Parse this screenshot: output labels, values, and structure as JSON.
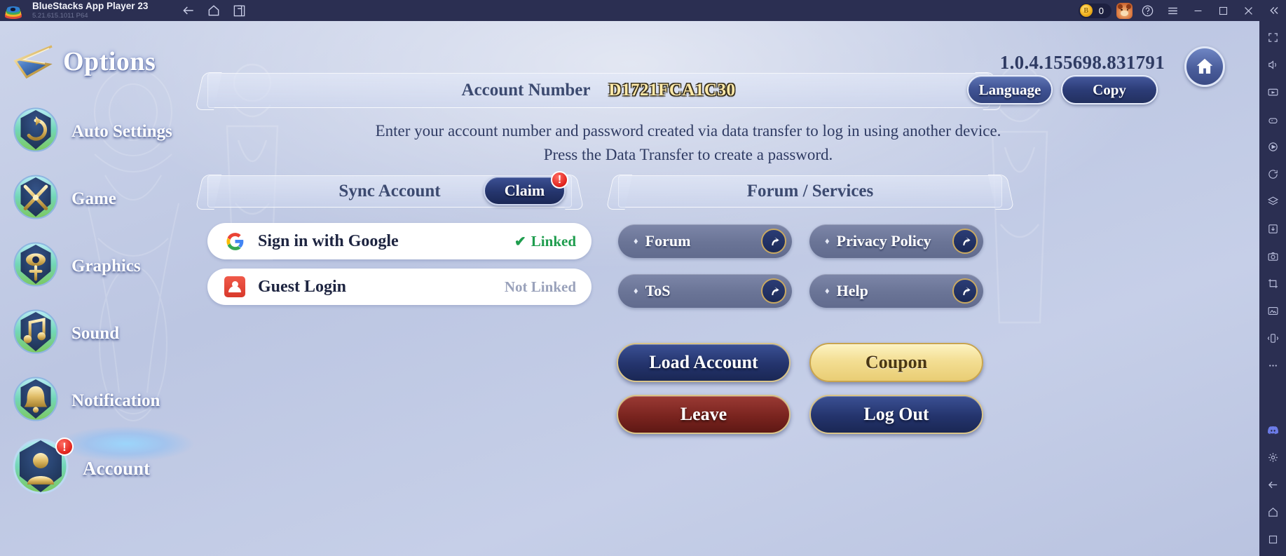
{
  "window": {
    "app_title": "BlueStacks App Player 23",
    "app_version": "5.21.615.1011  P64",
    "logo_icon": "bluestacks-logo-icon",
    "nav": [
      {
        "name": "back",
        "icon": "arrow-left-icon"
      },
      {
        "name": "home",
        "icon": "home-icon"
      },
      {
        "name": "multi-instance",
        "icon": "windows-copy-icon"
      }
    ],
    "coin_count": "0",
    "coin_icon": "gold-coin-icon",
    "avatar_icon": "bear-avatar-icon",
    "controls": [
      {
        "name": "help",
        "icon": "question-circle-icon"
      },
      {
        "name": "menu",
        "icon": "hamburger-icon"
      },
      {
        "name": "minimize",
        "icon": "minimize-icon"
      },
      {
        "name": "maximize",
        "icon": "maximize-icon"
      },
      {
        "name": "close",
        "icon": "close-icon"
      },
      {
        "name": "collapse-sidebar",
        "icon": "chevron-double-left-icon"
      }
    ]
  },
  "siderail": {
    "items": [
      {
        "name": "fullscreen",
        "icon": "expand-icon"
      },
      {
        "name": "volume",
        "icon": "speaker-icon"
      },
      {
        "name": "keymapping",
        "icon": "keyboard-play-icon"
      },
      {
        "name": "gamepad",
        "icon": "gamepad-icon"
      },
      {
        "name": "macro",
        "icon": "macro-record-icon"
      },
      {
        "name": "rotate",
        "icon": "rotate-icon"
      },
      {
        "name": "multi-instance-manager",
        "icon": "instance-stack-icon"
      },
      {
        "name": "install-apk",
        "icon": "apk-install-icon"
      },
      {
        "name": "screenshot",
        "icon": "camera-icon"
      },
      {
        "name": "crop-screenshot",
        "icon": "crop-icon"
      },
      {
        "name": "media-manager",
        "icon": "gallery-icon"
      },
      {
        "name": "shake",
        "icon": "shake-icon"
      },
      {
        "name": "more",
        "icon": "ellipsis-icon"
      },
      {
        "name": "discord",
        "icon": "discord-icon"
      },
      {
        "name": "settings",
        "icon": "gear-icon"
      },
      {
        "name": "back",
        "icon": "arrow-left-icon"
      },
      {
        "name": "home",
        "icon": "home-icon"
      },
      {
        "name": "recents",
        "icon": "recents-icon"
      }
    ]
  },
  "page": {
    "title": "Options",
    "title_icon": "options-arrow-icon",
    "version": "1.0.4.155698.831791",
    "home_button_icon": "house-icon"
  },
  "sidebar": {
    "items": [
      {
        "label": "Auto Settings",
        "icon": "auto-settings-badge-icon",
        "selected": false,
        "alert": false
      },
      {
        "label": "Game",
        "icon": "crossed-swords-badge-icon",
        "selected": false,
        "alert": false
      },
      {
        "label": "Graphics",
        "icon": "graphics-eye-badge-icon",
        "selected": false,
        "alert": false
      },
      {
        "label": "Sound",
        "icon": "music-note-badge-icon",
        "selected": false,
        "alert": false
      },
      {
        "label": "Notification",
        "icon": "bell-badge-icon",
        "selected": false,
        "alert": false
      },
      {
        "label": "Account",
        "icon": "person-badge-icon",
        "selected": true,
        "alert": true,
        "alert_text": "!"
      }
    ]
  },
  "account": {
    "number_label": "Account Number",
    "number_value": "D1721FCA1C30",
    "language_button": "Language",
    "copy_button": "Copy",
    "description_line1": "Enter your account number and password created via data transfer to log in using another device.",
    "description_line2": "Press the Data Transfer to create a password."
  },
  "sync": {
    "section_title": "Sync Account",
    "claim_button": "Claim",
    "claim_badge": "!",
    "logins": [
      {
        "name": "Sign in with Google",
        "icon": "google-g-icon",
        "status": "Linked",
        "linked": true,
        "check_icon": "checkmark-icon"
      },
      {
        "name": "Guest Login",
        "icon": "guest-person-icon",
        "status": "Not Linked",
        "linked": false
      }
    ]
  },
  "services": {
    "section_title": "Forum / Services",
    "bullet": "♦",
    "arrow_icon": "external-link-arrow-icon",
    "items": [
      {
        "label": "Forum"
      },
      {
        "label": "Privacy Policy"
      },
      {
        "label": "ToS"
      },
      {
        "label": "Help"
      }
    ]
  },
  "actions": [
    {
      "label": "Load Account",
      "style": "blue"
    },
    {
      "label": "Coupon",
      "style": "gold"
    },
    {
      "label": "Leave",
      "style": "red"
    },
    {
      "label": "Log Out",
      "style": "blue"
    }
  ],
  "colors": {
    "titlebar_bg": "#2b2f52",
    "panel_bg": "#c2cbe6",
    "accent_gold": "#ffe9a8",
    "linked_green": "#1f9d4e",
    "notlinked_grey": "#9aa2bb",
    "alert_red": "#e0221c",
    "button_blue": "#24346d",
    "button_red": "#7a241f",
    "button_gold": "#f3de93"
  }
}
